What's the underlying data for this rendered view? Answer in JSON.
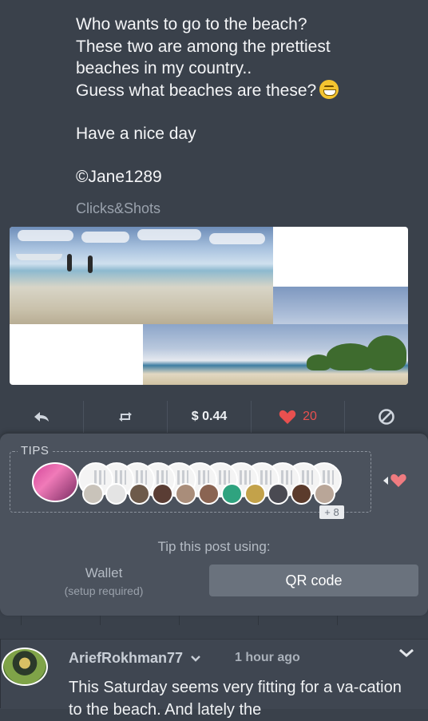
{
  "post": {
    "lines": [
      "Who wants to go to the beach?",
      "These two are among the prettiest",
      "beaches in my country..",
      "Guess what beaches are these?"
    ],
    "closing": "Have a nice day",
    "signature": "©Jane1289",
    "tagline": "Clicks&Shots"
  },
  "actions": {
    "payout": "$ 0.44",
    "likes": "20"
  },
  "tips": {
    "title": "TIPS",
    "more_count": "+ 8",
    "tip_using": "Tip this post using:",
    "wallet_label": "Wallet",
    "wallet_note": "(setup required)",
    "qr_label": "QR code"
  },
  "comment": {
    "username": "AriefRokhman77",
    "time": "1 hour ago",
    "text": "This Saturday seems very fitting for a va-cation to the beach. And lately the"
  },
  "icons": [
    "reply-icon",
    "resteem-icon",
    "heart-icon",
    "flag-icon",
    "chevron-down-icon"
  ],
  "colors": {
    "accent_red": "#e8504f",
    "background": "#3a414b",
    "panel": "#4b525d"
  }
}
